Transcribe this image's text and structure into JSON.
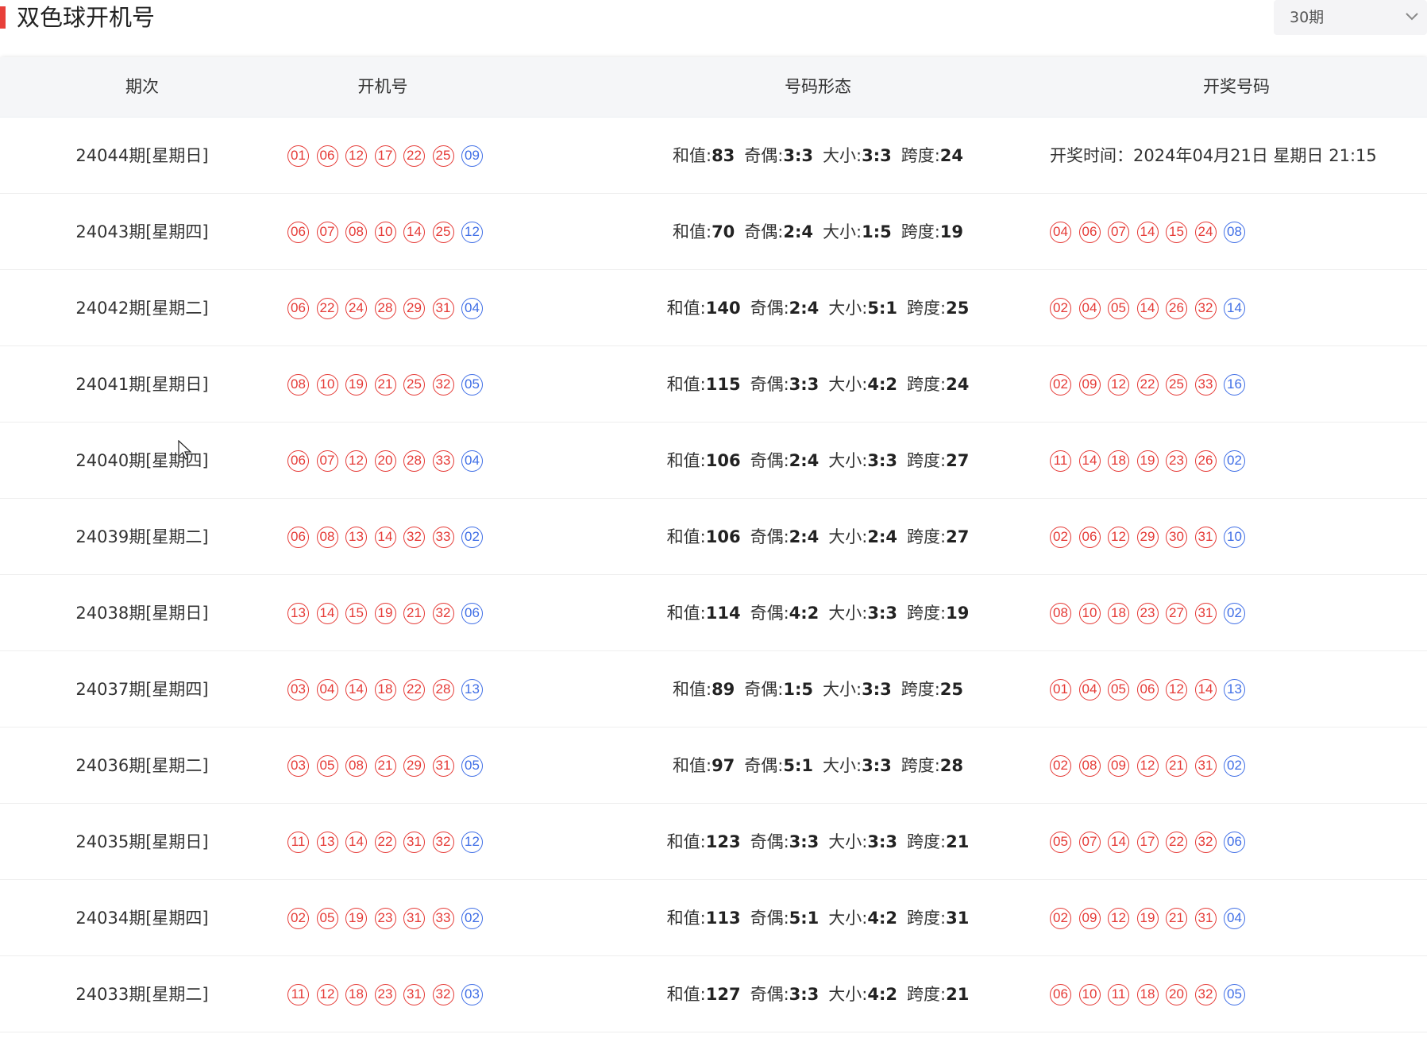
{
  "page_title": "双色球开机号",
  "period_select": {
    "value": "30期"
  },
  "table": {
    "headers": [
      "期次",
      "开机号",
      "号码形态",
      "开奖号码"
    ],
    "labels": {
      "sum": "和值:",
      "odd_even": "奇偶:",
      "big_small": "大小:",
      "span": "跨度:",
      "draw_time_prefix": "开奖时间："
    },
    "rows": [
      {
        "period": "24044期[星期日]",
        "machine_red": [
          "01",
          "06",
          "12",
          "17",
          "22",
          "25"
        ],
        "machine_blue": "09",
        "sum": "83",
        "odd_even": "3:3",
        "big_small": "3:3",
        "span": "24",
        "draw_time": "2024年04月21日 星期日 21:15"
      },
      {
        "period": "24043期[星期四]",
        "machine_red": [
          "06",
          "07",
          "08",
          "10",
          "14",
          "25"
        ],
        "machine_blue": "12",
        "sum": "70",
        "odd_even": "2:4",
        "big_small": "1:5",
        "span": "19",
        "win_red": [
          "04",
          "06",
          "07",
          "14",
          "15",
          "24"
        ],
        "win_blue": "08"
      },
      {
        "period": "24042期[星期二]",
        "machine_red": [
          "06",
          "22",
          "24",
          "28",
          "29",
          "31"
        ],
        "machine_blue": "04",
        "sum": "140",
        "odd_even": "2:4",
        "big_small": "5:1",
        "span": "25",
        "win_red": [
          "02",
          "04",
          "05",
          "14",
          "26",
          "32"
        ],
        "win_blue": "14"
      },
      {
        "period": "24041期[星期日]",
        "machine_red": [
          "08",
          "10",
          "19",
          "21",
          "25",
          "32"
        ],
        "machine_blue": "05",
        "sum": "115",
        "odd_even": "3:3",
        "big_small": "4:2",
        "span": "24",
        "win_red": [
          "02",
          "09",
          "12",
          "22",
          "25",
          "33"
        ],
        "win_blue": "16"
      },
      {
        "period": "24040期[星期四]",
        "machine_red": [
          "06",
          "07",
          "12",
          "20",
          "28",
          "33"
        ],
        "machine_blue": "04",
        "sum": "106",
        "odd_even": "2:4",
        "big_small": "3:3",
        "span": "27",
        "win_red": [
          "11",
          "14",
          "18",
          "19",
          "23",
          "26"
        ],
        "win_blue": "02"
      },
      {
        "period": "24039期[星期二]",
        "machine_red": [
          "06",
          "08",
          "13",
          "14",
          "32",
          "33"
        ],
        "machine_blue": "02",
        "sum": "106",
        "odd_even": "2:4",
        "big_small": "2:4",
        "span": "27",
        "win_red": [
          "02",
          "06",
          "12",
          "29",
          "30",
          "31"
        ],
        "win_blue": "10"
      },
      {
        "period": "24038期[星期日]",
        "machine_red": [
          "13",
          "14",
          "15",
          "19",
          "21",
          "32"
        ],
        "machine_blue": "06",
        "sum": "114",
        "odd_even": "4:2",
        "big_small": "3:3",
        "span": "19",
        "win_red": [
          "08",
          "10",
          "18",
          "23",
          "27",
          "31"
        ],
        "win_blue": "02"
      },
      {
        "period": "24037期[星期四]",
        "machine_red": [
          "03",
          "04",
          "14",
          "18",
          "22",
          "28"
        ],
        "machine_blue": "13",
        "sum": "89",
        "odd_even": "1:5",
        "big_small": "3:3",
        "span": "25",
        "win_red": [
          "01",
          "04",
          "05",
          "06",
          "12",
          "14"
        ],
        "win_blue": "13"
      },
      {
        "period": "24036期[星期二]",
        "machine_red": [
          "03",
          "05",
          "08",
          "21",
          "29",
          "31"
        ],
        "machine_blue": "05",
        "sum": "97",
        "odd_even": "5:1",
        "big_small": "3:3",
        "span": "28",
        "win_red": [
          "02",
          "08",
          "09",
          "12",
          "21",
          "31"
        ],
        "win_blue": "02"
      },
      {
        "period": "24035期[星期日]",
        "machine_red": [
          "11",
          "13",
          "14",
          "22",
          "31",
          "32"
        ],
        "machine_blue": "12",
        "sum": "123",
        "odd_even": "3:3",
        "big_small": "3:3",
        "span": "21",
        "win_red": [
          "05",
          "07",
          "14",
          "17",
          "22",
          "32"
        ],
        "win_blue": "06"
      },
      {
        "period": "24034期[星期四]",
        "machine_red": [
          "02",
          "05",
          "19",
          "23",
          "31",
          "33"
        ],
        "machine_blue": "02",
        "sum": "113",
        "odd_even": "5:1",
        "big_small": "4:2",
        "span": "31",
        "win_red": [
          "02",
          "09",
          "12",
          "19",
          "21",
          "31"
        ],
        "win_blue": "04"
      },
      {
        "period": "24033期[星期二]",
        "machine_red": [
          "11",
          "12",
          "18",
          "23",
          "31",
          "32"
        ],
        "machine_blue": "03",
        "sum": "127",
        "odd_even": "3:3",
        "big_small": "4:2",
        "span": "21",
        "win_red": [
          "06",
          "10",
          "11",
          "18",
          "20",
          "32"
        ],
        "win_blue": "05"
      }
    ]
  }
}
